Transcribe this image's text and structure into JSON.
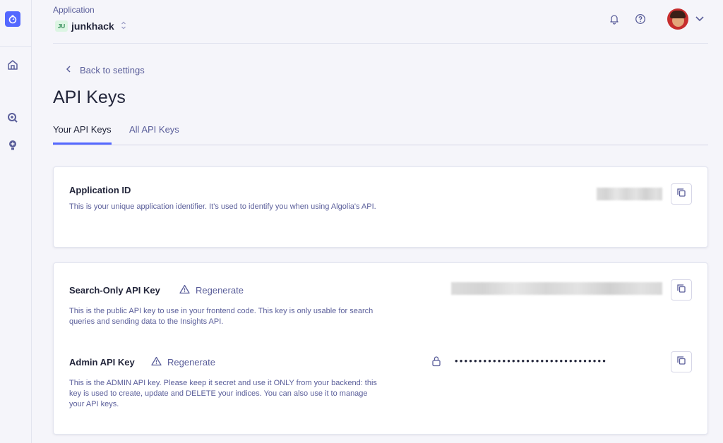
{
  "header": {
    "application_label": "Application",
    "app_badge": "JU",
    "app_name": "junkhack",
    "switch_glyph": "⌃⌄"
  },
  "nav": {
    "back_label": "Back to settings"
  },
  "page": {
    "title": "API Keys"
  },
  "tabs": [
    {
      "label": "Your API Keys",
      "active": true
    },
    {
      "label": "All API Keys",
      "active": false
    }
  ],
  "cards": {
    "application_id": {
      "title": "Application ID",
      "description": "This is your unique application identifier. It's used to identify you when using Algolia's API."
    },
    "search_key": {
      "title": "Search-Only API Key",
      "regenerate_label": "Regenerate",
      "description": "This is the public API key to use in your frontend code. This key is only usable for search queries and sending data to the Insights API."
    },
    "admin_key": {
      "title": "Admin API Key",
      "regenerate_label": "Regenerate",
      "description": "This is the ADMIN API key. Please keep it secret and use it ONLY from your backend: this key is used to create, update and DELETE your indices. You can also use it to manage your API keys.",
      "masked_value": "••••••••••••••••••••••••••••••••"
    }
  },
  "colors": {
    "accent": "#5468ff",
    "text": "#23263b",
    "muted": "#5a5e9a"
  },
  "icons": [
    "stopwatch-icon",
    "home-icon",
    "search-insight-icon",
    "bulb-icon",
    "bell-icon",
    "help-icon",
    "avatar",
    "chevron-down-icon",
    "chevron-left-icon",
    "warning-icon",
    "copy-icon",
    "lock-icon"
  ]
}
